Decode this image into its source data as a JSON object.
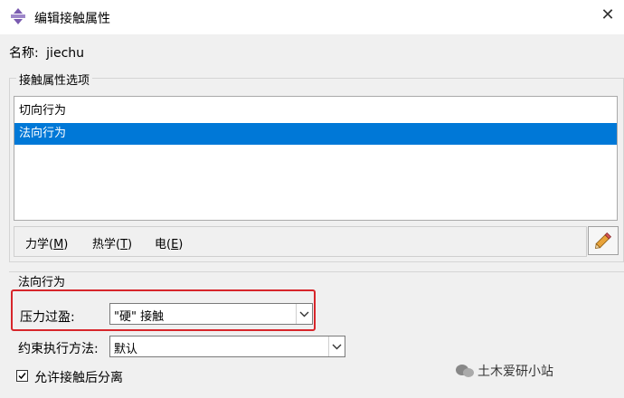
{
  "window": {
    "title": "编辑接触属性",
    "close_glyph": "✕"
  },
  "name": {
    "label": "名称:",
    "value": "jiechu"
  },
  "options_group": {
    "legend": "接触属性选项",
    "items": [
      {
        "label": "切向行为",
        "selected": false
      },
      {
        "label": "法向行为",
        "selected": true
      }
    ]
  },
  "menu": {
    "items": [
      {
        "text": "力学(",
        "key": "M",
        "suffix": ")"
      },
      {
        "text": "热学(",
        "key": "T",
        "suffix": ")"
      },
      {
        "text": "电(",
        "key": "E",
        "suffix": ")"
      }
    ]
  },
  "normal_behavior": {
    "section_label": "法向行为",
    "pressure_overclosure": {
      "label": "压力过盈:",
      "value": "\"硬\" 接触"
    },
    "constraint_method": {
      "label": "约束执行方法:",
      "value": "默认"
    },
    "allow_separation": {
      "label": "允许接触后分离",
      "checked": true
    }
  },
  "watermark": {
    "text": "土木爱研小站"
  },
  "colors": {
    "selection": "#0078d7",
    "highlight": "#d7262b"
  }
}
